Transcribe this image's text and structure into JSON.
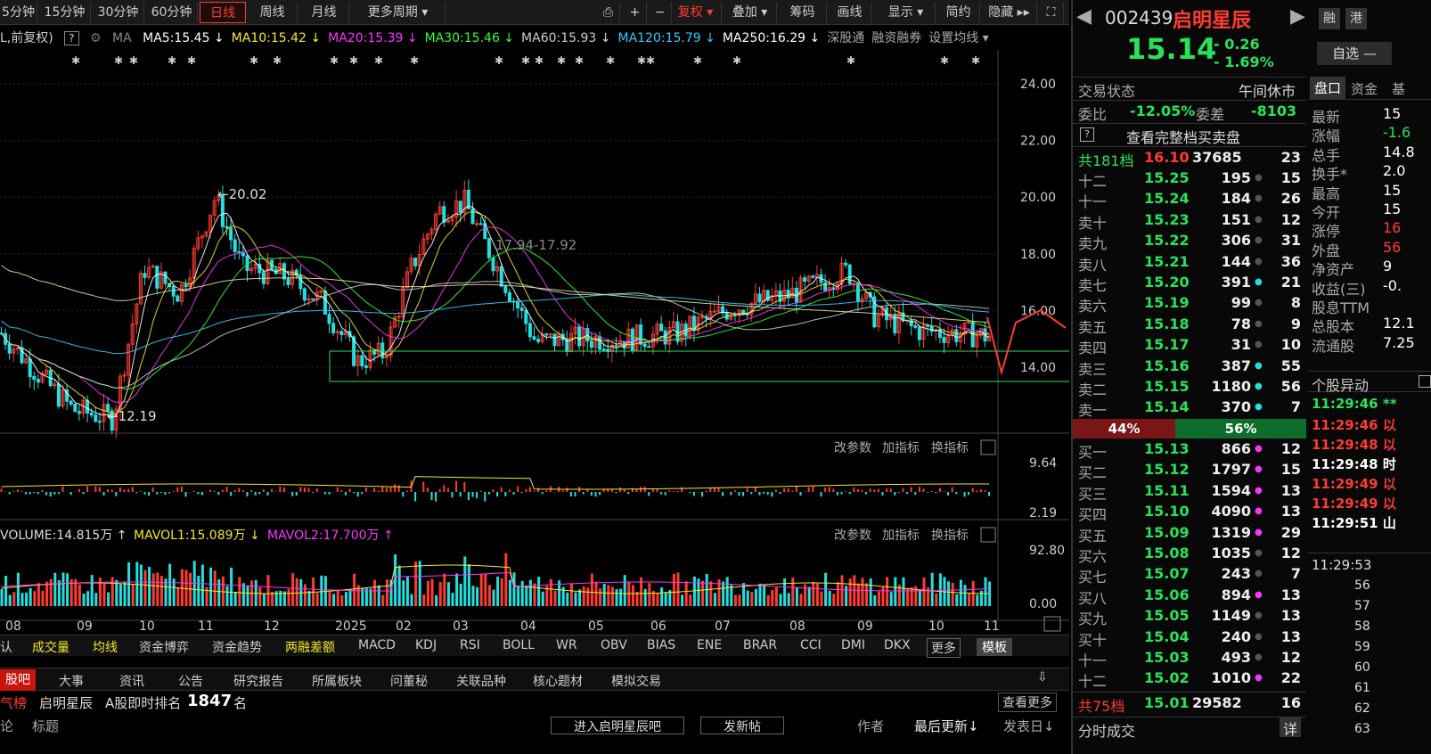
{
  "toolbar": {
    "periods": [
      "5分钟",
      "15分钟",
      "30分钟",
      "60分钟",
      "日线",
      "周线",
      "月线",
      "更多周期 ▾"
    ],
    "tools": [
      "复权 ▾",
      "叠加 ▾",
      "筹码",
      "画线",
      "显示 ▾",
      "简约",
      "隐藏 ▸▸"
    ]
  },
  "ma_line": {
    "prefix": "L,前复权)",
    "ma_label": "MA",
    "items": [
      {
        "text": "MA5:15.45 ↓",
        "color": "#ffffff"
      },
      {
        "text": "MA10:15.42 ↓",
        "color": "#f5e829"
      },
      {
        "text": "MA20:15.39 ↓",
        "color": "#ff33ff"
      },
      {
        "text": "MA30:15.46 ↓",
        "color": "#33ff33"
      },
      {
        "text": "MA60:15.93 ↓",
        "color": "#cccccc"
      },
      {
        "text": "MA120:15.79 ↓",
        "color": "#33ccff"
      },
      {
        "text": "MA250:16.29 ↓",
        "color": "#ffffff"
      }
    ],
    "links": [
      "深股通",
      "融资融券",
      "设置均线 ▾"
    ]
  },
  "chart_data": {
    "type": "candlestick",
    "y_ticks": [
      "24.00",
      "22.00",
      "20.00",
      "18.00",
      "16.00",
      "14.00"
    ],
    "x_ticks": [
      "08",
      "09",
      "10",
      "11",
      "12",
      "2025",
      "02",
      "03",
      "04",
      "05",
      "06",
      "07",
      "08",
      "09",
      "10",
      "11"
    ],
    "annotations": [
      "←20.02",
      "←12.19",
      "17.94-17.92"
    ],
    "macd_panel": {
      "ticks": [
        "9.64",
        "2.19"
      ],
      "buttons": [
        "改参数",
        "加指标",
        "换指标"
      ]
    },
    "volume_panel": {
      "title": "VOLUME:14.815万 ↑",
      "mavol1": "MAVOL1:15.089万 ↓",
      "mavol2": "MAVOL2:17.700万 ↑",
      "ticks": [
        "92.80",
        "0.00"
      ],
      "buttons": [
        "改参数",
        "加指标",
        "换指标"
      ]
    }
  },
  "bottom_tabs": [
    "认",
    "成交量",
    "均线",
    "资金博弈",
    "资金趋势",
    "两融差额",
    "MACD",
    "KDJ",
    "RSI",
    "BOLL",
    "WR",
    "OBV",
    "BIAS",
    "ENE",
    "BRAR",
    "CCI",
    "DMI",
    "DKX",
    "更多",
    "模板"
  ],
  "info_tabs": [
    "股吧",
    "大事",
    "资讯",
    "公告",
    "研究报告",
    "所属板块",
    "问董秘",
    "关联品种",
    "核心题材",
    "模拟交易"
  ],
  "rank_row": {
    "left": "气榜",
    "name": "启明星辰",
    "label": "A股即时排名",
    "rank": "1847",
    "unit": "名",
    "more": "查看更多"
  },
  "foot_row": {
    "left": "论",
    "title": "标题",
    "enter": "进入启明星辰吧",
    "post": "发新帖",
    "author": "作者",
    "updated": "最后更新↓",
    "posted": "发表日↓"
  },
  "stock": {
    "code": "002439",
    "name": "启明星辰",
    "price": "15.14",
    "change": "- 0.26",
    "pct": "- 1.69%",
    "tags": [
      "融",
      "港"
    ],
    "pick": "自选 —"
  },
  "status": {
    "label": "交易状态",
    "value": "午间休市"
  },
  "ratio": {
    "label1": "委比",
    "v1": "-12.05%",
    "label2": "委差",
    "v2": "-8103"
  },
  "full_book": "查看完整档买卖盘",
  "sell_total": {
    "label": "共181档",
    "price": "16.10",
    "vol": "37685",
    "cnt": "23"
  },
  "asks": [
    {
      "lbl": "十二",
      "p": "15.25",
      "v": "195",
      "c": "15",
      "dot": "#555"
    },
    {
      "lbl": "十一",
      "p": "15.24",
      "v": "184",
      "c": "26",
      "dot": "#555"
    },
    {
      "lbl": "卖十",
      "p": "15.23",
      "v": "151",
      "c": "12",
      "dot": "#555"
    },
    {
      "lbl": "卖九",
      "p": "15.22",
      "v": "306",
      "c": "31",
      "dot": "#555"
    },
    {
      "lbl": "卖八",
      "p": "15.21",
      "v": "144",
      "c": "36",
      "dot": "#555"
    },
    {
      "lbl": "卖七",
      "p": "15.20",
      "v": "391",
      "c": "21",
      "dot": "#22e0e0"
    },
    {
      "lbl": "卖六",
      "p": "15.19",
      "v": "99",
      "c": "8",
      "dot": "#555"
    },
    {
      "lbl": "卖五",
      "p": "15.18",
      "v": "78",
      "c": "9",
      "dot": "#555"
    },
    {
      "lbl": "卖四",
      "p": "15.17",
      "v": "31",
      "c": "10",
      "dot": "#555"
    },
    {
      "lbl": "卖三",
      "p": "15.16",
      "v": "387",
      "c": "55",
      "dot": "#22e0e0"
    },
    {
      "lbl": "卖二",
      "p": "15.15",
      "v": "1180",
      "c": "56",
      "dot": "#22e0e0"
    },
    {
      "lbl": "卖一",
      "p": "15.14",
      "v": "370",
      "c": "7",
      "dot": "#22e0e0"
    }
  ],
  "split": {
    "buy": "44%",
    "sell": "56%",
    "buy_frac": 0.44
  },
  "bids": [
    {
      "lbl": "买一",
      "p": "15.13",
      "v": "866",
      "c": "12",
      "dot": "#ff33ff"
    },
    {
      "lbl": "买二",
      "p": "15.12",
      "v": "1797",
      "c": "15",
      "dot": "#ff33ff"
    },
    {
      "lbl": "买三",
      "p": "15.11",
      "v": "1594",
      "c": "13",
      "dot": "#ff33ff"
    },
    {
      "lbl": "买四",
      "p": "15.10",
      "v": "4090",
      "c": "13",
      "dot": "#ff33ff"
    },
    {
      "lbl": "买五",
      "p": "15.09",
      "v": "1319",
      "c": "29",
      "dot": "#ff33ff"
    },
    {
      "lbl": "买六",
      "p": "15.08",
      "v": "1035",
      "c": "12",
      "dot": "#555"
    },
    {
      "lbl": "买七",
      "p": "15.07",
      "v": "243",
      "c": "7",
      "dot": "#555"
    },
    {
      "lbl": "买八",
      "p": "15.06",
      "v": "894",
      "c": "13",
      "dot": "#ff33ff"
    },
    {
      "lbl": "买九",
      "p": "15.05",
      "v": "1149",
      "c": "13",
      "dot": "#555"
    },
    {
      "lbl": "买十",
      "p": "15.04",
      "v": "240",
      "c": "13",
      "dot": "#555"
    },
    {
      "lbl": "十一",
      "p": "15.03",
      "v": "493",
      "c": "12",
      "dot": "#555"
    },
    {
      "lbl": "十二",
      "p": "15.02",
      "v": "1010",
      "c": "22",
      "dot": "#ff33ff"
    }
  ],
  "buy_total": {
    "label": "共75档",
    "price": "15.01",
    "vol": "29582",
    "cnt": "16"
  },
  "tick_footer": {
    "label": "分时成交",
    "btn": "详"
  },
  "side_tabs": [
    "盘口",
    "资金",
    "基"
  ],
  "quote": [
    {
      "k": "最新",
      "v": "15"
    },
    {
      "k": "涨幅",
      "v": "-1.6"
    },
    {
      "k": "总手",
      "v": "14.8"
    },
    {
      "k": "换手*",
      "v": "2.0"
    },
    {
      "k": "最高",
      "v": "15"
    },
    {
      "k": "今开",
      "v": "15"
    },
    {
      "k": "涨停",
      "v": "16"
    },
    {
      "k": "外盘",
      "v": "56"
    },
    {
      "k": "净资产",
      "v": "9"
    },
    {
      "k": "收益(三)",
      "v": "-0."
    },
    {
      "k": "股息TTM",
      "v": ""
    },
    {
      "k": "总股本",
      "v": "12.1"
    },
    {
      "k": "流通股",
      "v": "7.25"
    }
  ],
  "movement_title": "个股异动",
  "movements": [
    {
      "t": "11:29:46",
      "s": "**",
      "c": "#2ae25a"
    },
    {
      "t": "11:29:46",
      "s": "以",
      "c": "#ff3b30"
    },
    {
      "t": "11:29:48",
      "s": "以",
      "c": "#ff3b30"
    },
    {
      "t": "11:29:48",
      "s": "时",
      "c": "#fff"
    },
    {
      "t": "11:29:49",
      "s": "以",
      "c": "#ff3b30"
    },
    {
      "t": "11:29:49",
      "s": "以",
      "c": "#ff3b30"
    },
    {
      "t": "11:29:51",
      "s": "山",
      "c": "#fff"
    }
  ],
  "tick_time": "11:29:53",
  "tick_seconds": [
    "56",
    "57",
    "58",
    "59",
    "60",
    "61",
    "62",
    "63"
  ]
}
